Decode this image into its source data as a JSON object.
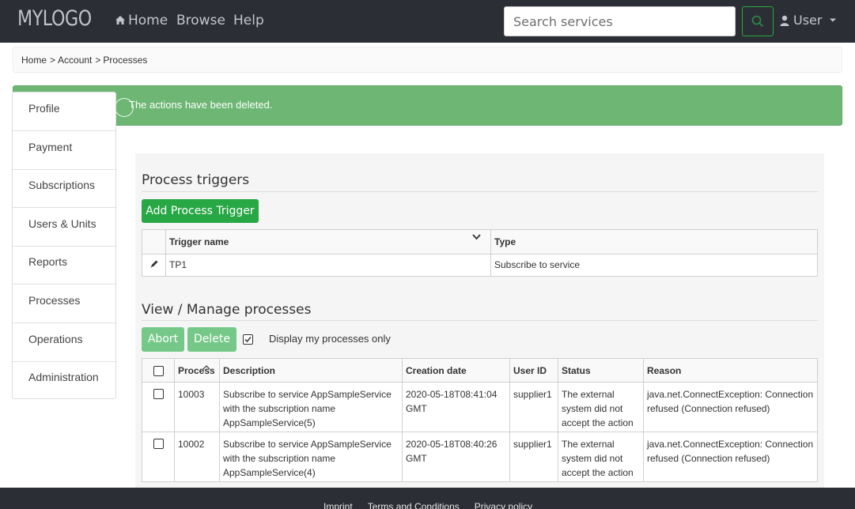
{
  "navbar": {
    "logo": "MYLOGO",
    "home": "Home",
    "browse": "Browse",
    "help": "Help",
    "search_placeholder": "Search services",
    "user": "User",
    "home_icon": "home-icon",
    "search_icon": "search-icon",
    "user_icon": "user-icon",
    "caret_icon": "caret-down-icon"
  },
  "breadcrumb": [
    "Home",
    "Account",
    "Processes"
  ],
  "alert": {
    "message": "The actions have been deleted."
  },
  "sidebar": {
    "items": [
      "Profile",
      "Payment",
      "Subscriptions",
      "Users & Units",
      "Reports",
      "Processes",
      "Operations",
      "Administration"
    ]
  },
  "triggers": {
    "title": "Process triggers",
    "add_button": "Add Process Trigger",
    "columns": [
      "Trigger name",
      "Type"
    ],
    "rows": [
      {
        "name": "TP1",
        "type": "Subscribe to service"
      }
    ]
  },
  "processes": {
    "title": "View / Manage processes",
    "abort_button": "Abort",
    "delete_button": "Delete",
    "display_own_label": "Display my processes only",
    "display_own_checked": true,
    "columns": [
      "Process",
      "Description",
      "Creation date",
      "User ID",
      "Status",
      "Reason"
    ],
    "rows": [
      {
        "id": "10003",
        "description": "Subscribe to service AppSampleService with the subscription name AppSampleService(5)",
        "date": "2020-05-18T08:41:04 GMT",
        "user": "supplier1",
        "status": "The external system did not accept the action",
        "reason": "java.net.ConnectException: Connection refused (Connection refused)"
      },
      {
        "id": "10002",
        "description": "Subscribe to service AppSampleService with the subscription name AppSampleService(4)",
        "date": "2020-05-18T08:40:26 GMT",
        "user": "supplier1",
        "status": "The external system did not accept the action",
        "reason": "java.net.ConnectException: Connection refused (Connection refused)"
      }
    ]
  },
  "footer": {
    "links": [
      "Imprint",
      "Terms and Conditions",
      "Privacy policy"
    ]
  },
  "colors": {
    "navbar": "#2b2f35",
    "success": "#6db673",
    "primary_button": "#28a745"
  }
}
